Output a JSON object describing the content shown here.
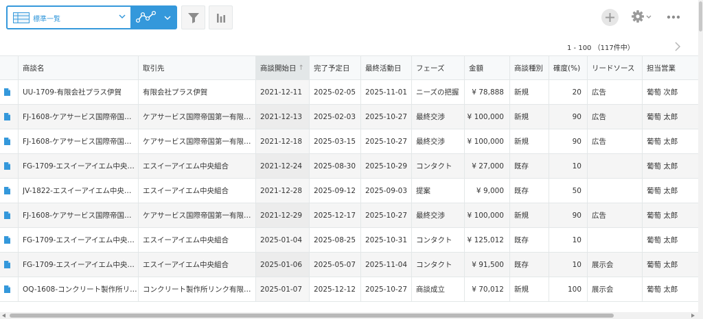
{
  "toolbar": {
    "view_name": "標準一覧"
  },
  "pager": {
    "range": "1 - 100",
    "total": "（117件中）"
  },
  "columns": [
    "商談名",
    "取引先",
    "商談開始日",
    "完了予定日",
    "最終活動日",
    "フェーズ",
    "金額",
    "商談種別",
    "確度(%)",
    "リードソース",
    "担当営業"
  ],
  "sort_indicator": "↑",
  "rows": [
    [
      "UU-1709-有限会社プラス伊賀",
      "有限会社プラス伊賀",
      "2021-12-11",
      "2025-02-05",
      "2025-11-01",
      "ニーズの把握",
      "¥ 78,888",
      "新規",
      "20",
      "広告",
      "葡萄 次郎"
    ],
    [
      "FJ-1608-ケアサービス国際帝国…",
      "ケアサービス国際帝国第一有限…",
      "2021-12-13",
      "2025-02-03",
      "2025-10-27",
      "最終交渉",
      "¥ 100,000",
      "新規",
      "90",
      "広告",
      "葡萄 太郎"
    ],
    [
      "FJ-1608-ケアサービス国際帝国…",
      "ケアサービス国際帝国第一有限…",
      "2021-12-18",
      "2025-03-15",
      "2025-10-27",
      "最終交渉",
      "¥ 100,000",
      "新規",
      "90",
      "広告",
      "葡萄 太郎"
    ],
    [
      "FG-1709-エスイーアイエム中央…",
      "エスイーアイエム中央組合",
      "2021-12-24",
      "2025-08-30",
      "2025-10-29",
      "コンタクト",
      "¥ 27,000",
      "既存",
      "10",
      "",
      "葡萄 太郎"
    ],
    [
      "JV-1822-エスイーアイエム中央…",
      "エスイーアイエム中央組合",
      "2021-12-28",
      "2025-09-12",
      "2025-09-03",
      "提案",
      "¥ 9,000",
      "既存",
      "50",
      "",
      "葡萄 太郎"
    ],
    [
      "FJ-1608-ケアサービス国際帝国…",
      "ケアサービス国際帝国第一有限…",
      "2021-12-29",
      "2025-12-17",
      "2025-10-27",
      "最終交渉",
      "¥ 100,000",
      "新規",
      "90",
      "広告",
      "葡萄 太郎"
    ],
    [
      "FG-1709-エスイーアイエム中央…",
      "エスイーアイエム中央組合",
      "2025-01-04",
      "2025-08-25",
      "2025-10-31",
      "コンタクト",
      "¥ 125,012",
      "既存",
      "10",
      "",
      "葡萄 太郎"
    ],
    [
      "FG-1709-エスイーアイエム中央…",
      "エスイーアイエム中央組合",
      "2025-01-06",
      "2025-05-07",
      "2025-11-04",
      "コンタクト",
      "¥ 91,500",
      "既存",
      "10",
      "展示会",
      "葡萄 太郎"
    ],
    [
      "OQ-1608-コンクリート製作所リ…",
      "コンクリート製作所リンク有限…",
      "2025-01-07",
      "2025-12-12",
      "2025-10-27",
      "商談成立",
      "¥ 70,012",
      "新規",
      "100",
      "展示会",
      "葡萄 太郎"
    ]
  ],
  "colors": {
    "accent": "#3498db",
    "doc_icon": "#3498db"
  }
}
